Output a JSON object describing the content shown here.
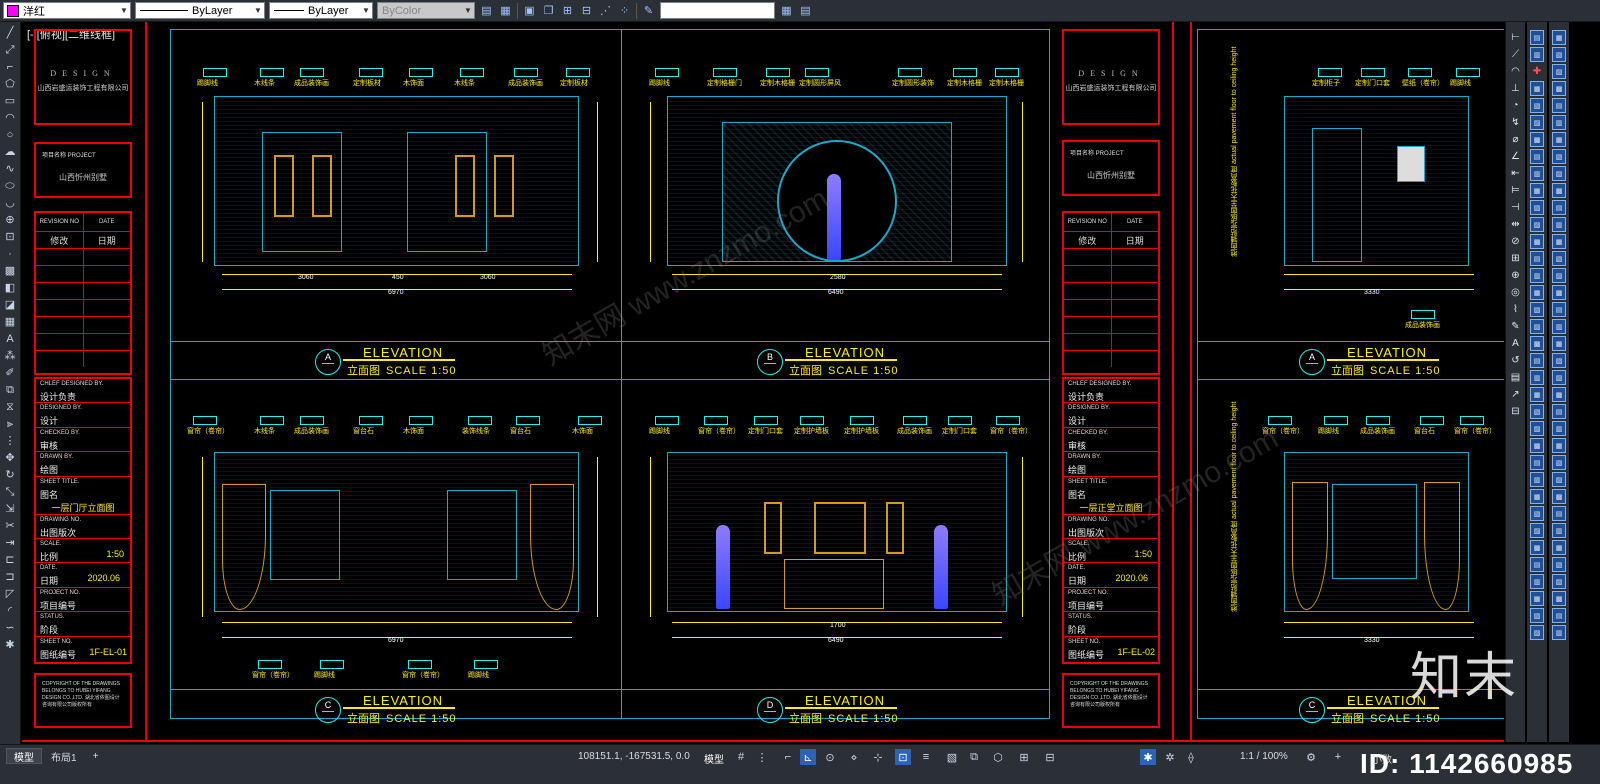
{
  "toolbar": {
    "color_value": "洋红",
    "linetype_value": "ByLayer",
    "lineweight_value": "ByLayer",
    "plotstyle_value": "ByColor"
  },
  "viewport": {
    "label": "[-][俯视][二维线框]"
  },
  "title_block_left": {
    "design_logo": "DESIGN",
    "company": "山西岩盛运装饰工程有限公司",
    "project_name_key": "项目名称 PROJECT",
    "project_name_value": "山西忻州别墅",
    "revision_no_label": "REVISION NO",
    "date_label": "DATE",
    "revision_value": "修改",
    "date_value": "日期",
    "chief_designer_k": "CHLEF DESIGNED BY.",
    "chief_designer_v": "设计负责",
    "designed_by_k": "DESIGNED BY.",
    "designed_by_v": "设计",
    "checked_by_k": "CHECKED BY.",
    "checked_by_v": "审核",
    "drawn_by_k": "DRAWN BY.",
    "drawn_by_v": "绘图",
    "sheet_title_k": "SHEET TITLE.",
    "sheet_title_v": "图名",
    "sheet_title_value": "一层门厅立面图",
    "drawing_no_k": "DRAWING NO.",
    "drawing_no_v": "出图版次",
    "scale_k": "SCALE.",
    "scale_v": "比例",
    "scale_value": "1:50",
    "date_k": "DATE.",
    "date_v": "日期",
    "date_value2": "2020.06",
    "project_no_k": "PROJECT NO.",
    "project_no_v": "项目编号",
    "status_k": "STATUS.",
    "status_v": "阶段",
    "sheet_no_k": "SHEET NO.",
    "sheet_no_v": "图纸编号",
    "sheet_no_value": "1F-EL-01",
    "copyright": "COPYRIGHT OF THE DRAWINGS BELONGS TO HUBEI YIFANG DESIGN CO.,LTD. 湖北省依图设计咨询有限公司版权所有"
  },
  "title_block_right": {
    "design_logo": "DESIGN",
    "company": "山西岩盛运装饰工程有限公司",
    "project_name_key": "项目名称 PROJECT",
    "project_name_value": "山西忻州别墅",
    "revision_no_label": "REVISION NO",
    "date_label": "DATE",
    "revision_value": "修改",
    "date_value": "日期",
    "chief_designer_k": "CHLEF DESIGNED BY.",
    "chief_designer_v": "设计负责",
    "designed_by_k": "DESIGNED BY.",
    "designed_by_v": "设计",
    "checked_by_k": "CHECKED BY.",
    "checked_by_v": "审核",
    "drawn_by_k": "DRAWN BY.",
    "drawn_by_v": "绘图",
    "sheet_title_k": "SHEET TITLE.",
    "sheet_title_v": "图名",
    "sheet_title_value": "一层正堂立面图",
    "drawing_no_k": "DRAWING NO.",
    "drawing_no_v": "出图版次",
    "scale_k": "SCALE.",
    "scale_v": "比例",
    "scale_value": "1:50",
    "date_k": "DATE.",
    "date_v": "日期",
    "date_value2": "2020.06",
    "project_no_k": "PROJECT NO.",
    "project_no_v": "项目编号",
    "status_k": "STATUS.",
    "status_v": "阶段",
    "sheet_no_k": "SHEET NO.",
    "sheet_no_v": "图纸编号",
    "sheet_no_value": "1F-EL-02",
    "copyright": "COPYRIGHT OF THE DRAWINGS BELONGS TO HUBEI YIFANG DESIGN CO.,LTD. 湖北省依图设计咨询有限公司版权所有"
  },
  "elevations": {
    "word": "ELEVATION",
    "scale_cn": "立面图",
    "scale_en": "SCALE 1:50",
    "a": "A",
    "b": "B",
    "c": "C",
    "d": "D"
  },
  "dims": {
    "a_total": "6970",
    "a_left": "3060",
    "a_right": "3060",
    "a_mid": "450",
    "b_total": "6490",
    "b_mid": "2580",
    "c_total": "6970",
    "d_total": "6490",
    "d_mid": "1700",
    "e_total": "3330",
    "f_total": "3330"
  },
  "tags": {
    "a": [
      "踢脚线",
      "木线条",
      "成品装饰画",
      "定制板材",
      "木饰面",
      "木线条",
      "成品装饰画",
      "定制板材"
    ],
    "b": [
      "踢脚线",
      "定制格栅门",
      "定制木格栅",
      "定制圆形屏风",
      "定制圆形装饰",
      "定制木格栅",
      "定制木格栅"
    ],
    "c": [
      "窗帘（卷帘）",
      "木线条",
      "成品装饰画",
      "窗台石",
      "木饰面",
      "装饰线条",
      "窗台石",
      "木饰面"
    ],
    "d": [
      "踢脚线",
      "窗帘（卷帘）",
      "定制门口套",
      "定制护墙板",
      "定制护墙板",
      "成品装饰画",
      "定制门口套",
      "窗帘（卷帘）"
    ],
    "e": [
      "定制柜子",
      "定制门口套",
      "壁纸（卷帘）",
      "踢脚线"
    ],
    "f": [
      "窗帘（卷帘）",
      "踢脚线",
      "成品装饰画",
      "窗台石",
      "窗帘（卷帘）"
    ],
    "c_bottom": [
      "窗帘（卷帘）",
      "踢脚线",
      "窗帘（卷帘）",
      "踢脚线"
    ],
    "e_bottom": "成品装饰画"
  },
  "vertical_note": "地面铺贴完成面至天花板高度 actual pavement floor to ceiling height",
  "status": {
    "tab_model": "模型",
    "tab_layout": "布局1",
    "tab_add": "+",
    "coords": "108151.1, -167531.5, 0.0",
    "model_btn": "模型",
    "scale": "1:1 / 100%",
    "units": "小数"
  },
  "watermark": {
    "brand": "知末",
    "id": "ID: 1142660985",
    "faint": "知末网 www.znzmo.com"
  }
}
